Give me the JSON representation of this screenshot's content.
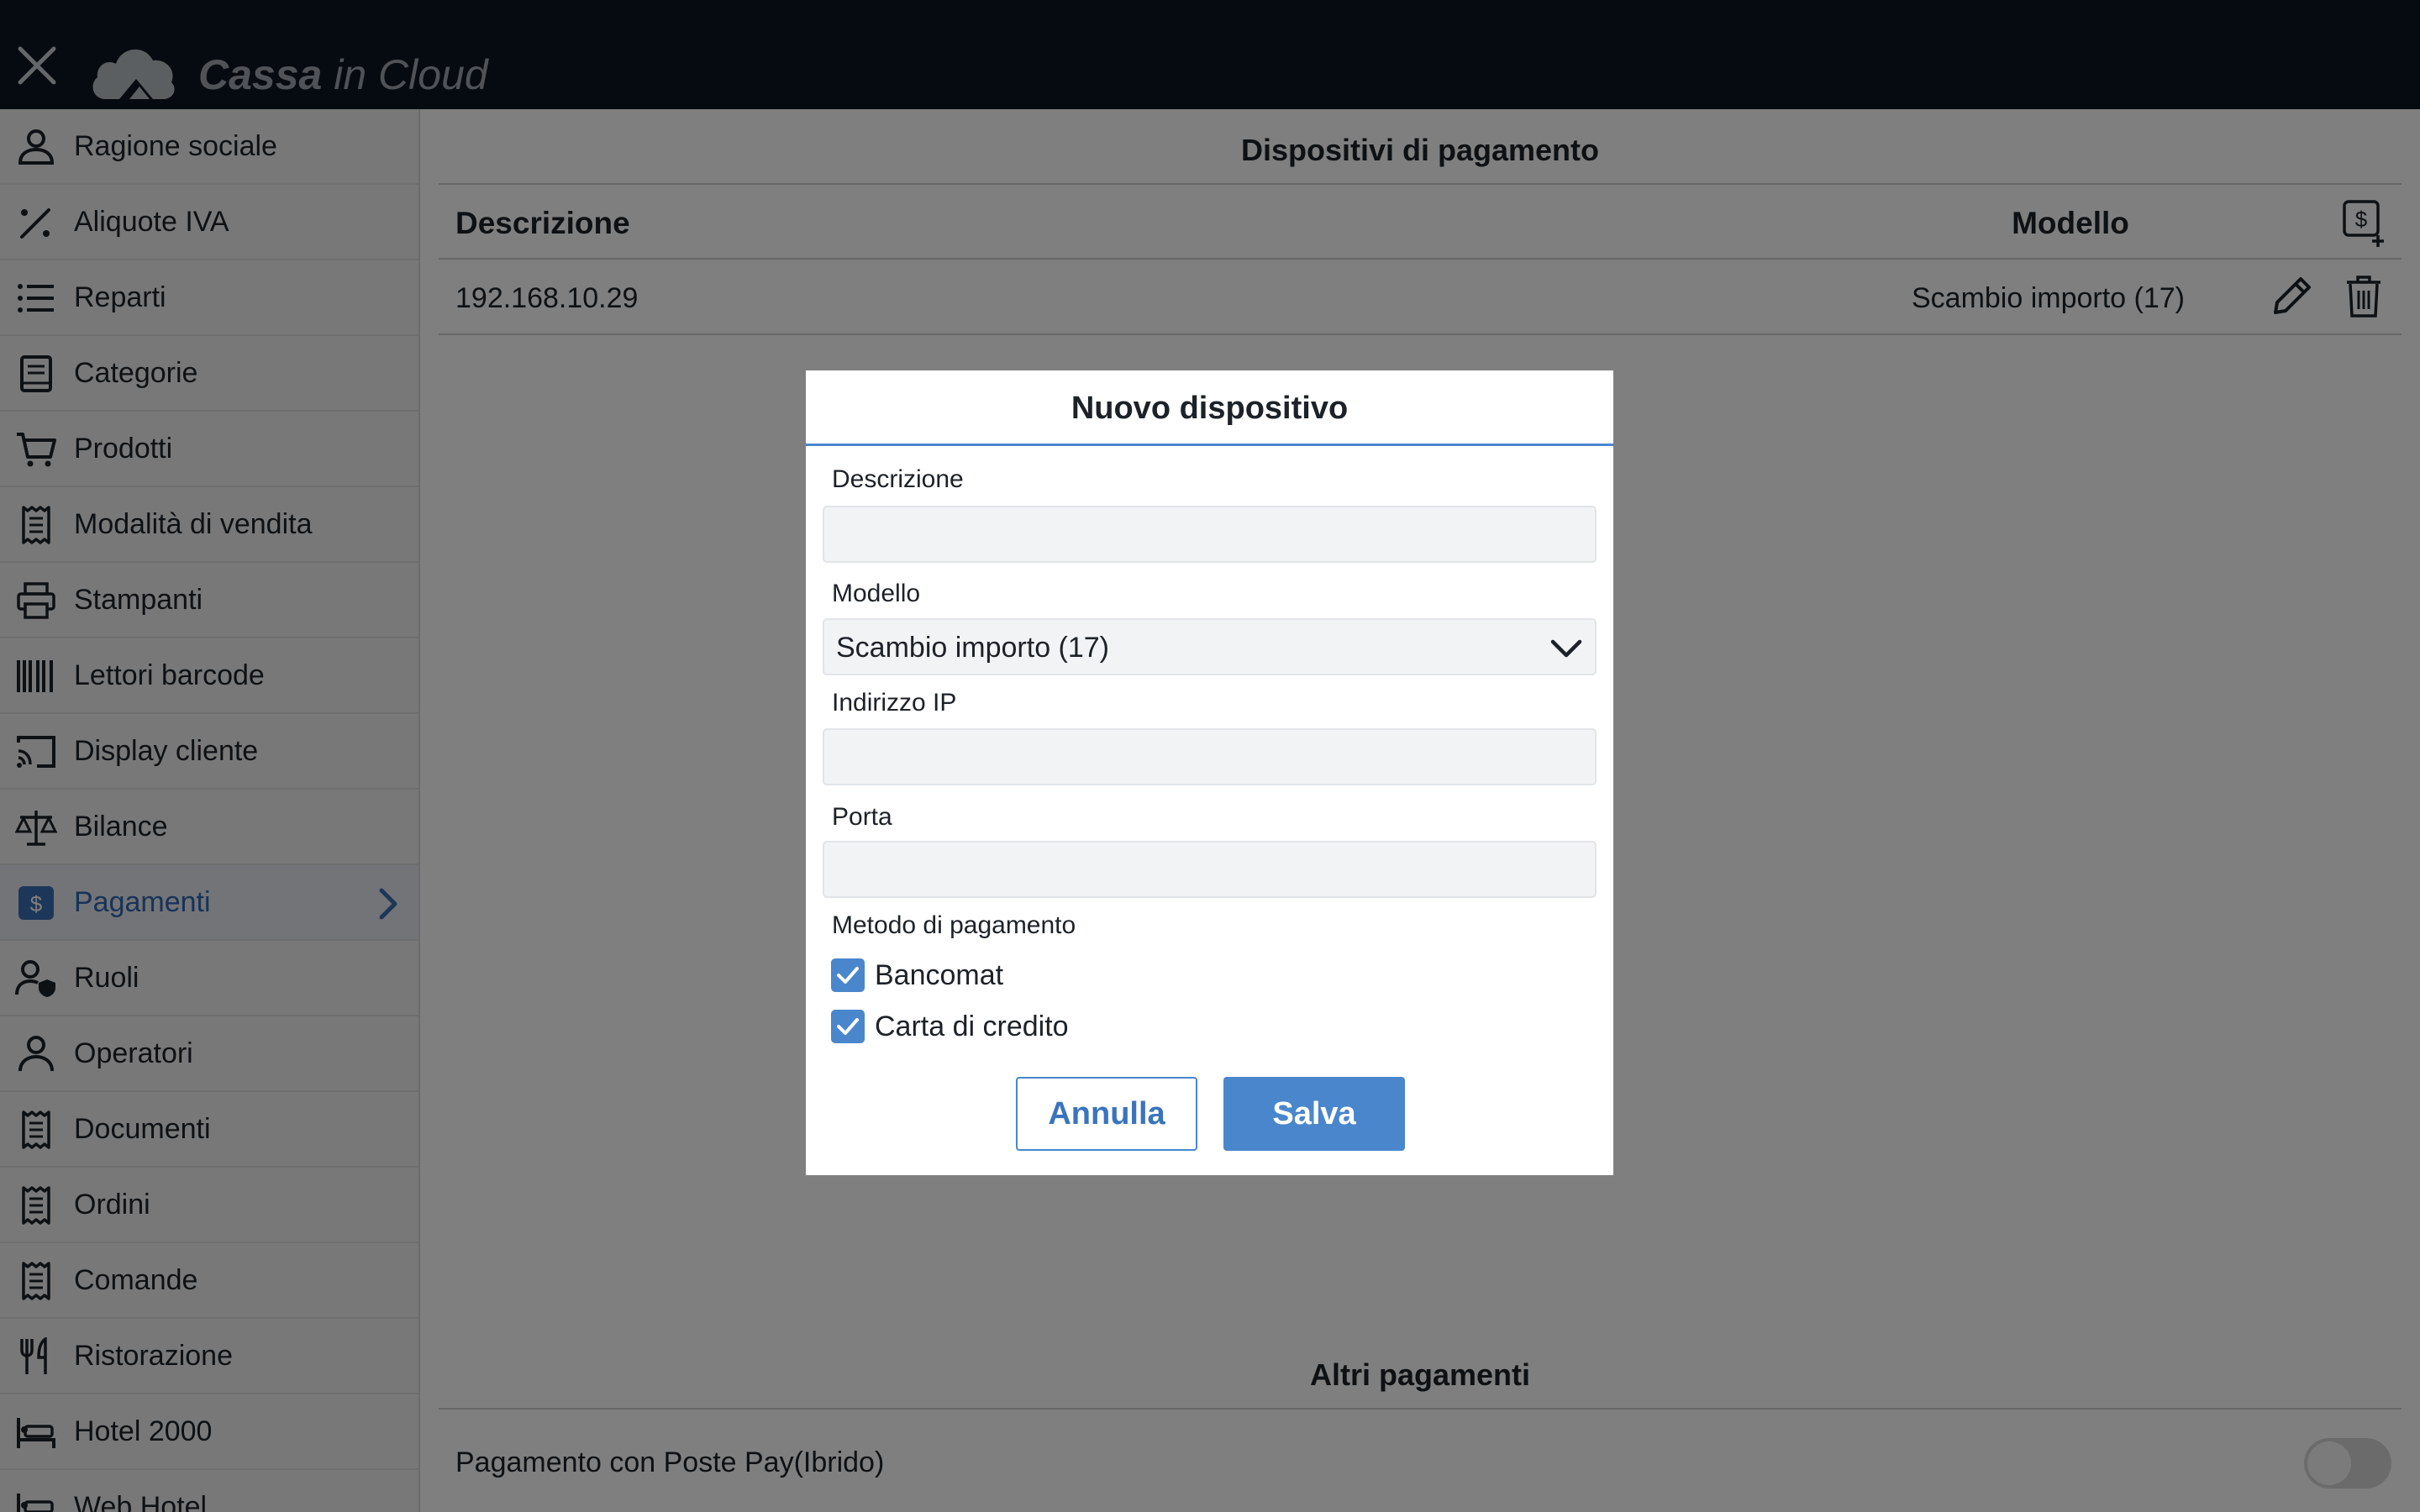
{
  "header": {
    "brand_bold": "Cassa",
    "brand_light": " in Cloud"
  },
  "sidebar": {
    "items": [
      {
        "label": "Ragione sociale",
        "icon": "user-id-icon"
      },
      {
        "label": "Aliquote IVA",
        "icon": "percent-icon"
      },
      {
        "label": "Reparti",
        "icon": "list-icon"
      },
      {
        "label": "Categorie",
        "icon": "book-icon"
      },
      {
        "label": "Prodotti",
        "icon": "cart-icon"
      },
      {
        "label": "Modalità di vendita",
        "icon": "receipt-icon"
      },
      {
        "label": "Stampanti",
        "icon": "printer-icon"
      },
      {
        "label": "Lettori barcode",
        "icon": "barcode-icon"
      },
      {
        "label": "Display cliente",
        "icon": "cast-icon"
      },
      {
        "label": "Bilance",
        "icon": "scale-icon"
      },
      {
        "label": "Pagamenti",
        "icon": "dollar-icon",
        "active": true
      },
      {
        "label": "Ruoli",
        "icon": "user-shield-icon"
      },
      {
        "label": "Operatori",
        "icon": "user-icon"
      },
      {
        "label": "Documenti",
        "icon": "receipt-icon"
      },
      {
        "label": "Ordini",
        "icon": "receipt-icon"
      },
      {
        "label": "Comande",
        "icon": "receipt-icon"
      },
      {
        "label": "Ristorazione",
        "icon": "fork-knife-icon"
      },
      {
        "label": "Hotel 2000",
        "icon": "bed-icon"
      },
      {
        "label": "Web Hotel",
        "icon": "bed-icon"
      }
    ]
  },
  "main": {
    "section_title": "Dispositivi di pagamento",
    "table": {
      "col_description": "Descrizione",
      "col_model": "Modello",
      "rows": [
        {
          "description": "192.168.10.29",
          "model": "Scambio importo (17)"
        }
      ]
    },
    "other_title": "Altri pagamenti",
    "other_items": [
      {
        "label": "Pagamento con Poste Pay(Ibrido)",
        "enabled": false
      }
    ]
  },
  "modal": {
    "title": "Nuovo dispositivo",
    "description_label": "Descrizione",
    "description_value": "",
    "model_label": "Modello",
    "model_value": "Scambio importo (17)",
    "ip_label": "Indirizzo IP",
    "ip_value": "",
    "port_label": "Porta",
    "port_value": "",
    "payment_method_label": "Metodo di pagamento",
    "methods": [
      {
        "label": "Bancomat",
        "checked": true
      },
      {
        "label": "Carta di credito",
        "checked": true
      }
    ],
    "cancel_label": "Annulla",
    "save_label": "Salva"
  },
  "colors": {
    "header": "#0d1622",
    "accent": "#4a86cc",
    "active_text": "#2f66b0"
  }
}
